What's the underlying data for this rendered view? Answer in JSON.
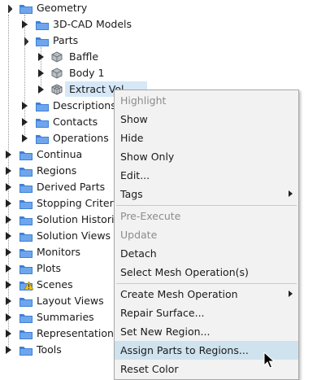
{
  "tree": {
    "geometry": "Geometry",
    "cad_models": "3D-CAD Models",
    "parts": "Parts",
    "baffle": "Baffle",
    "body1": "Body 1",
    "extract": "Extract Vol",
    "descriptions": "Descriptions",
    "contacts": "Contacts",
    "operations": "Operations",
    "continua": "Continua",
    "regions": "Regions",
    "derived_parts": "Derived Parts",
    "stopping_criteria": "Stopping Criteria",
    "solution_histories": "Solution Histories",
    "solution_views": "Solution Views",
    "monitors": "Monitors",
    "plots": "Plots",
    "scenes": "Scenes",
    "layout_views": "Layout Views",
    "summaries": "Summaries",
    "representations": "Representations",
    "tools": "Tools"
  },
  "menu": {
    "highlight": "Highlight",
    "show": "Show",
    "hide": "Hide",
    "show_only": "Show Only",
    "edit": "Edit...",
    "tags": "Tags",
    "pre_execute": "Pre-Execute",
    "update": "Update",
    "detach": "Detach",
    "select_mesh_operation": "Select Mesh Operation(s)",
    "create_mesh_operation": "Create Mesh Operation",
    "repair_surface": "Repair Surface...",
    "set_new_region": "Set New Region...",
    "assign_parts": "Assign Parts to Regions...",
    "reset_color": "Reset Color"
  },
  "colors": {
    "folder": "#3f7fd6",
    "menu_hover": "#cfe3ee",
    "selection": "#d6e8f7"
  }
}
